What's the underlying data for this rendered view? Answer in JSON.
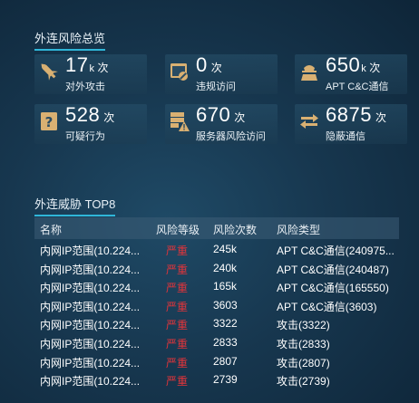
{
  "overview": {
    "title": "外连风险总览",
    "cards": [
      {
        "value": "17",
        "suffix": "k",
        "unit": "次",
        "label": "对外攻击",
        "icon": "missile-icon"
      },
      {
        "value": "0",
        "suffix": "",
        "unit": "次",
        "label": "违规访问",
        "icon": "blocked-access-icon"
      },
      {
        "value": "650",
        "suffix": "k",
        "unit": "次",
        "label": "APT C&C通信",
        "icon": "hacker-icon"
      },
      {
        "value": "528",
        "suffix": "",
        "unit": "次",
        "label": "可疑行为",
        "icon": "question-icon"
      },
      {
        "value": "670",
        "suffix": "",
        "unit": "次",
        "label": "服务器风险访问",
        "icon": "server-warning-icon"
      },
      {
        "value": "6875",
        "suffix": "",
        "unit": "次",
        "label": "隐蔽通信",
        "icon": "exchange-arrows-icon"
      }
    ]
  },
  "threats": {
    "title": "外连威胁 TOP8",
    "columns": [
      "名称",
      "风险等级",
      "风险次数",
      "风险类型"
    ],
    "rows": [
      {
        "name": "内网IP范围(10.224...",
        "level": "严重",
        "count": "245k",
        "type": "APT C&C通信(240975..."
      },
      {
        "name": "内网IP范围(10.224...",
        "level": "严重",
        "count": "240k",
        "type": "APT C&C通信(240487)"
      },
      {
        "name": "内网IP范围(10.224...",
        "level": "严重",
        "count": "165k",
        "type": "APT C&C通信(165550)"
      },
      {
        "name": "内网IP范围(10.224...",
        "level": "严重",
        "count": "3603",
        "type": "APT C&C通信(3603)"
      },
      {
        "name": "内网IP范围(10.224...",
        "level": "严重",
        "count": "3322",
        "type": "攻击(3322)"
      },
      {
        "name": "内网IP范围(10.224...",
        "level": "严重",
        "count": "2833",
        "type": "攻击(2833)"
      },
      {
        "name": "内网IP范围(10.224...",
        "level": "严重",
        "count": "2807",
        "type": "攻击(2807)"
      },
      {
        "name": "内网IP范围(10.224...",
        "level": "严重",
        "count": "2739",
        "type": "攻击(2739)"
      }
    ]
  },
  "colors": {
    "accent": "#2fb6d8",
    "icon": "#d9b072",
    "severe": "#e4343a"
  }
}
